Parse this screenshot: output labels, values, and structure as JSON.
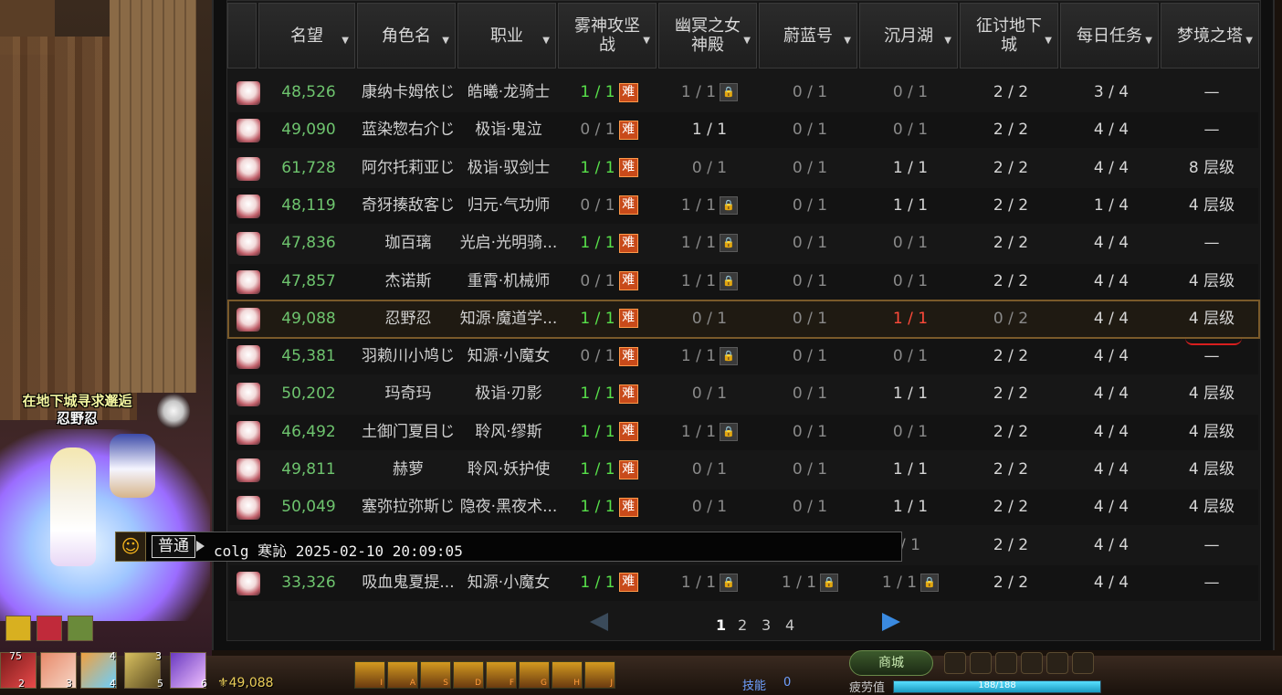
{
  "columns": [
    "",
    "名望",
    "角色名",
    "职业",
    "雾神攻坚战",
    "幽冥之女神殿",
    "蔚蓝号",
    "沉月湖",
    "征讨地下城",
    "每日任务",
    "梦境之塔"
  ],
  "rows": [
    {
      "rep": "48,526",
      "name": "康纳卡姆依じ",
      "job": "皓曦·龙骑士",
      "fog": "1 / 1",
      "fog_s": "done",
      "fog_hard": "难",
      "netherb": "1 / 1",
      "netherb_s": "dim",
      "nether_lock": true,
      "azure": "0 / 1",
      "azure_s": "dim",
      "azure_lock": false,
      "moon": "0 / 1",
      "moon_s": "dim",
      "moon_lock": false,
      "dungeon": "2 / 2",
      "dungeon_s": "norm",
      "daily": "3 / 4",
      "tower": "—"
    },
    {
      "rep": "49,090",
      "name": "蓝染惣右介じ",
      "job": "极诣·鬼泣",
      "fog": "0 / 1",
      "fog_s": "dim",
      "fog_hard": "难",
      "netherb": "1 / 1",
      "netherb_s": "norm",
      "nether_lock": false,
      "azure": "0 / 1",
      "azure_s": "dim",
      "azure_lock": false,
      "moon": "0 / 1",
      "moon_s": "dim",
      "moon_lock": false,
      "dungeon": "2 / 2",
      "dungeon_s": "norm",
      "daily": "4 / 4",
      "tower": "—"
    },
    {
      "rep": "61,728",
      "name": "阿尔托莉亚じ",
      "job": "极诣·驭剑士",
      "fog": "1 / 1",
      "fog_s": "done",
      "fog_hard": "难",
      "netherb": "0 / 1",
      "netherb_s": "dim",
      "nether_lock": false,
      "azure": "0 / 1",
      "azure_s": "dim",
      "azure_lock": false,
      "moon": "1 / 1",
      "moon_s": "norm",
      "moon_lock": false,
      "dungeon": "2 / 2",
      "dungeon_s": "norm",
      "daily": "4 / 4",
      "tower": "8 层级"
    },
    {
      "rep": "48,119",
      "name": "奇犽揍敌客じ",
      "job": "归元·气功师",
      "fog": "0 / 1",
      "fog_s": "dim",
      "fog_hard": "难",
      "netherb": "1 / 1",
      "netherb_s": "dim",
      "nether_lock": true,
      "azure": "0 / 1",
      "azure_s": "dim",
      "azure_lock": false,
      "moon": "1 / 1",
      "moon_s": "norm",
      "moon_lock": false,
      "dungeon": "2 / 2",
      "dungeon_s": "norm",
      "daily": "1 / 4",
      "tower": "4 层级"
    },
    {
      "rep": "47,836",
      "name": "珈百璃",
      "job": "光启·光明骑...",
      "fog": "1 / 1",
      "fog_s": "done",
      "fog_hard": "难",
      "netherb": "1 / 1",
      "netherb_s": "dim",
      "nether_lock": true,
      "azure": "0 / 1",
      "azure_s": "dim",
      "azure_lock": false,
      "moon": "0 / 1",
      "moon_s": "dim",
      "moon_lock": false,
      "dungeon": "2 / 2",
      "dungeon_s": "norm",
      "daily": "4 / 4",
      "tower": "—"
    },
    {
      "rep": "47,857",
      "name": "杰诺斯",
      "job": "重霄·机械师",
      "fog": "0 / 1",
      "fog_s": "dim",
      "fog_hard": "难",
      "netherb": "1 / 1",
      "netherb_s": "dim",
      "nether_lock": true,
      "azure": "0 / 1",
      "azure_s": "dim",
      "azure_lock": false,
      "moon": "0 / 1",
      "moon_s": "dim",
      "moon_lock": false,
      "dungeon": "2 / 2",
      "dungeon_s": "norm",
      "daily": "4 / 4",
      "tower": "4 层级"
    },
    {
      "rep": "49,088",
      "name": "忍野忍",
      "job": "知源·魔道学...",
      "fog": "1 / 1",
      "fog_s": "done",
      "fog_hard": "难",
      "netherb": "0 / 1",
      "netherb_s": "dim",
      "nether_lock": false,
      "azure": "0 / 1",
      "azure_s": "dim",
      "azure_lock": false,
      "moon": "1 / 1",
      "moon_s": "fail",
      "moon_lock": false,
      "dungeon": "0 / 2",
      "dungeon_s": "dim",
      "daily": "4 / 4",
      "tower": "4 层级",
      "selected": true
    },
    {
      "rep": "45,381",
      "name": "羽赖川小鸠じ",
      "job": "知源·小魔女",
      "fog": "0 / 1",
      "fog_s": "dim",
      "fog_hard": "难",
      "netherb": "1 / 1",
      "netherb_s": "dim",
      "nether_lock": true,
      "azure": "0 / 1",
      "azure_s": "dim",
      "azure_lock": false,
      "moon": "0 / 1",
      "moon_s": "dim",
      "moon_lock": false,
      "dungeon": "2 / 2",
      "dungeon_s": "norm",
      "daily": "4 / 4",
      "tower": "—"
    },
    {
      "rep": "50,202",
      "name": "玛奇玛",
      "job": "极诣·刃影",
      "fog": "1 / 1",
      "fog_s": "done",
      "fog_hard": "难",
      "netherb": "0 / 1",
      "netherb_s": "dim",
      "nether_lock": false,
      "azure": "0 / 1",
      "azure_s": "dim",
      "azure_lock": false,
      "moon": "1 / 1",
      "moon_s": "norm",
      "moon_lock": false,
      "dungeon": "2 / 2",
      "dungeon_s": "norm",
      "daily": "4 / 4",
      "tower": "4 层级"
    },
    {
      "rep": "46,492",
      "name": "土御门夏目じ",
      "job": "聆风·缪斯",
      "fog": "1 / 1",
      "fog_s": "done",
      "fog_hard": "难",
      "netherb": "1 / 1",
      "netherb_s": "dim",
      "nether_lock": true,
      "azure": "0 / 1",
      "azure_s": "dim",
      "azure_lock": false,
      "moon": "0 / 1",
      "moon_s": "dim",
      "moon_lock": false,
      "dungeon": "2 / 2",
      "dungeon_s": "norm",
      "daily": "4 / 4",
      "tower": "4 层级"
    },
    {
      "rep": "49,811",
      "name": "赫萝",
      "job": "聆风·妖护使",
      "fog": "1 / 1",
      "fog_s": "done",
      "fog_hard": "难",
      "netherb": "0 / 1",
      "netherb_s": "dim",
      "nether_lock": false,
      "azure": "0 / 1",
      "azure_s": "dim",
      "azure_lock": false,
      "moon": "1 / 1",
      "moon_s": "norm",
      "moon_lock": false,
      "dungeon": "2 / 2",
      "dungeon_s": "norm",
      "daily": "4 / 4",
      "tower": "4 层级"
    },
    {
      "rep": "50,049",
      "name": "塞弥拉弥斯じ",
      "job": "隐夜·黑夜术...",
      "fog": "1 / 1",
      "fog_s": "done",
      "fog_hard": "难",
      "netherb": "0 / 1",
      "netherb_s": "dim",
      "nether_lock": false,
      "azure": "0 / 1",
      "azure_s": "dim",
      "azure_lock": false,
      "moon": "1 / 1",
      "moon_s": "norm",
      "moon_lock": false,
      "dungeon": "2 / 2",
      "dungeon_s": "norm",
      "daily": "4 / 4",
      "tower": "4 层级"
    },
    {
      "rep": "",
      "name": "",
      "job": "",
      "fog": "",
      "fog_s": "dim",
      "fog_hard": "",
      "netherb": "",
      "netherb_s": "dim",
      "nether_lock": false,
      "azure": "",
      "azure_s": "dim",
      "azure_lock": false,
      "moon": "/ 1",
      "moon_s": "dim",
      "moon_lock": false,
      "dungeon": "2 / 2",
      "dungeon_s": "norm",
      "daily": "4 / 4",
      "tower": "—"
    },
    {
      "rep": "33,326",
      "name": "吸血鬼夏提...",
      "job": "知源·小魔女",
      "fog": "1 / 1",
      "fog_s": "done",
      "fog_hard": "难",
      "netherb": "1 / 1",
      "netherb_s": "dim",
      "nether_lock": true,
      "azure": "1 / 1",
      "azure_s": "dim",
      "azure_lock": true,
      "moon": "1 / 1",
      "moon_s": "dim",
      "moon_lock": true,
      "dungeon": "2 / 2",
      "dungeon_s": "norm",
      "daily": "4 / 4",
      "tower": "—"
    }
  ],
  "pagination": {
    "pages": [
      "1",
      "2",
      "3",
      "4"
    ],
    "current": "1"
  },
  "chat": {
    "channel": "普通",
    "text": "colg 寒訫 2025-02-10 20:09:05",
    "face_icon": "smiley-icon"
  },
  "npc_label": {
    "line1": "在地下城寻求邂逅",
    "line2": "忍野忍"
  },
  "hud": {
    "gold": "49,088",
    "skill_label": "技能",
    "skill_points": "0",
    "fatigue_label": "疲劳值",
    "fatigue_text": "188/188",
    "fatigue_fraction": 1.0,
    "shop_label": "商城",
    "item_counts": [
      "75",
      "2",
      "3",
      "4",
      "4",
      "3",
      "5",
      "6"
    ],
    "quick_keys": [
      "I",
      "A",
      "S",
      "D",
      "F",
      "G",
      "H",
      "J"
    ]
  },
  "colors": {
    "done": "#57e04a",
    "fail": "#ff4a3a",
    "rep": "#6ec46e",
    "hard_badge": "#c84a1a",
    "page_arrow": "#3a8ae0"
  }
}
